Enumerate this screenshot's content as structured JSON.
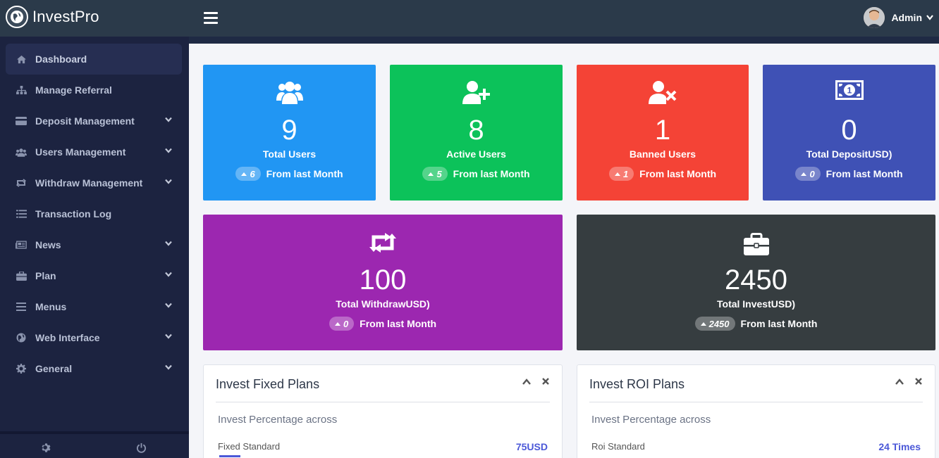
{
  "app": {
    "name": "InvestPro"
  },
  "header": {
    "user_name": "Admin"
  },
  "sidebar": {
    "items": [
      {
        "label": "Dashboard",
        "icon": "home-icon",
        "active": true,
        "has_submenu": false
      },
      {
        "label": "Manage Referral",
        "icon": "sitemap-icon",
        "has_submenu": false
      },
      {
        "label": "Deposit Management",
        "icon": "credit-card-icon",
        "has_submenu": true
      },
      {
        "label": "Users Management",
        "icon": "users-icon",
        "has_submenu": true
      },
      {
        "label": "Withdraw Management",
        "icon": "retweet-icon",
        "has_submenu": true
      },
      {
        "label": "Transaction Log",
        "icon": "list-icon",
        "has_submenu": false
      },
      {
        "label": "News",
        "icon": "newspaper-icon",
        "has_submenu": true
      },
      {
        "label": "Plan",
        "icon": "briefcase-icon",
        "has_submenu": true
      },
      {
        "label": "Menus",
        "icon": "bars-icon",
        "has_submenu": true
      },
      {
        "label": "Web Interface",
        "icon": "globe-icon",
        "has_submenu": true
      },
      {
        "label": "General",
        "icon": "cog-icon",
        "has_submenu": true
      }
    ],
    "footer": {
      "settings_icon": "cog-icon",
      "power_icon": "power-icon"
    }
  },
  "stats": [
    {
      "value": "9",
      "label": "Total Users",
      "delta": "6",
      "trend_text": "From last Month",
      "color": "#2196f3",
      "icon": "users-icon"
    },
    {
      "value": "8",
      "label": "Active Users",
      "delta": "5",
      "trend_text": "From last Month",
      "color": "#0cc25a",
      "icon": "user-plus-icon"
    },
    {
      "value": "1",
      "label": "Banned Users",
      "delta": "1",
      "trend_text": "From last Month",
      "color": "#f44336",
      "icon": "user-times-icon"
    },
    {
      "value": "0",
      "label": "Total DepositUSD)",
      "delta": "0",
      "trend_text": "From last Month",
      "color": "#3f51b5",
      "icon": "money-bill-icon"
    },
    {
      "value": "100",
      "label": "Total WithdrawUSD)",
      "delta": "0",
      "trend_text": "From last Month",
      "color": "#9c27b0",
      "icon": "retweet-icon"
    },
    {
      "value": "2450",
      "label": "Total InvestUSD)",
      "delta": "2450",
      "trend_text": "From last Month",
      "color": "#363d40",
      "icon": "briefcase-icon"
    }
  ],
  "panels": [
    {
      "title": "Invest Fixed Plans",
      "subtitle": "Invest Percentage across",
      "plan_name": "Fixed Standard",
      "plan_value": "75USD"
    },
    {
      "title": "Invest ROI Plans",
      "subtitle": "Invest Percentage across",
      "plan_name": "Roi Standard",
      "plan_value": "24 Times"
    }
  ],
  "colors": {
    "accent": "#4b58d8",
    "sidebar_bg": "#1c2340",
    "topbar_bg": "#2b3a4a"
  }
}
